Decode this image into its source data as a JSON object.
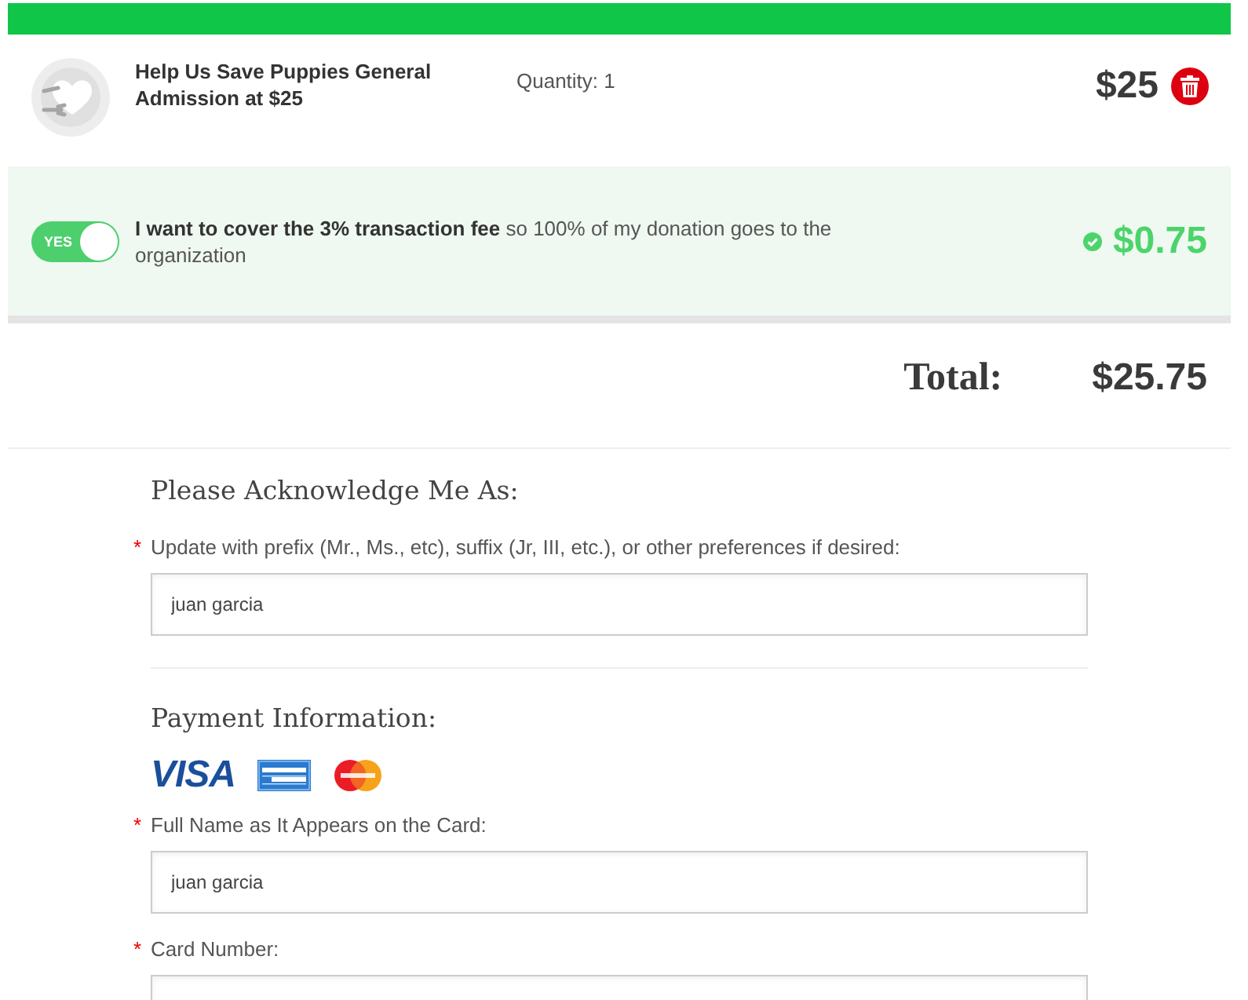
{
  "cart_item": {
    "title": "Help Us Save Puppies General Admission at $25",
    "quantity": "Quantity: 1",
    "price": "$25"
  },
  "fee_option": {
    "on": true,
    "toggle_label": "YES",
    "text": "**I want to cover the 3% transaction fee** so 100% of my donation goes to the organization",
    "amount": "$0.75"
  },
  "total": {
    "label": "Total:",
    "amount": "$25.75"
  },
  "sections": [
    {
      "heading": "Please Acknowledge Me As:",
      "fields": [
        {
          "required_mark": "*",
          "label": "Update with prefix (Mr., Ms., etc), suffix (Jr, III, etc.), or other preferences if desired:",
          "value": "juan garcia"
        }
      ]
    },
    {
      "heading": "Payment Information:",
      "card_logos": [
        {
          "kind": "visa",
          "text": "VISA"
        },
        {
          "kind": "amex"
        },
        {
          "kind": "mastercard"
        }
      ],
      "fields": [
        {
          "required_mark": "*",
          "label": "Full Name as It Appears on the Card:",
          "value": "juan garcia"
        },
        {
          "required_mark": "*",
          "label": "Card Number:"
        }
      ]
    }
  ]
}
